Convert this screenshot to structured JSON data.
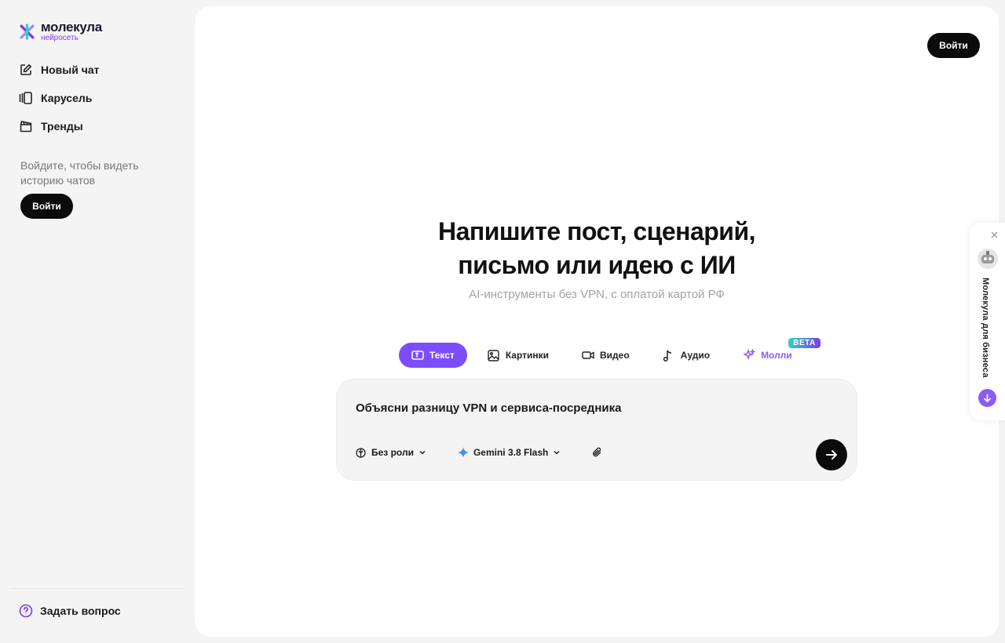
{
  "brand": {
    "name": "молекула",
    "sub": "нейросеть",
    "accent": "#7c4dff"
  },
  "sidebar": {
    "items": [
      {
        "label": "Новый чат",
        "icon": "edit-icon"
      },
      {
        "label": "Карусель",
        "icon": "carousel-icon"
      },
      {
        "label": "Тренды",
        "icon": "clapperboard-icon"
      }
    ],
    "login_hint": "Войдите, чтобы видеть историю чатов",
    "login_label": "Войти",
    "help_label": "Задать вопрос"
  },
  "header": {
    "login_label": "Войти"
  },
  "hero": {
    "title_line1": "Напишите пост, сценарий,",
    "title_line2": "письмо или идею с ИИ",
    "subtitle": "AI-инструменты без VPN, с оплатой картой РФ"
  },
  "tabs": [
    {
      "label": "Текст",
      "icon": "text-icon",
      "active": true
    },
    {
      "label": "Картинки",
      "icon": "image-icon"
    },
    {
      "label": "Видео",
      "icon": "video-icon"
    },
    {
      "label": "Аудио",
      "icon": "music-note-icon"
    },
    {
      "label": "Молли",
      "icon": "sparkles-icon",
      "badge": "BETA"
    }
  ],
  "composer": {
    "text": "Объясни разницу VPN и сервиса-посредника",
    "role_label": "Без роли",
    "model_label": "Gemini 3.8 Flash"
  },
  "business_widget": {
    "label": "Молекула для бизнеса"
  }
}
